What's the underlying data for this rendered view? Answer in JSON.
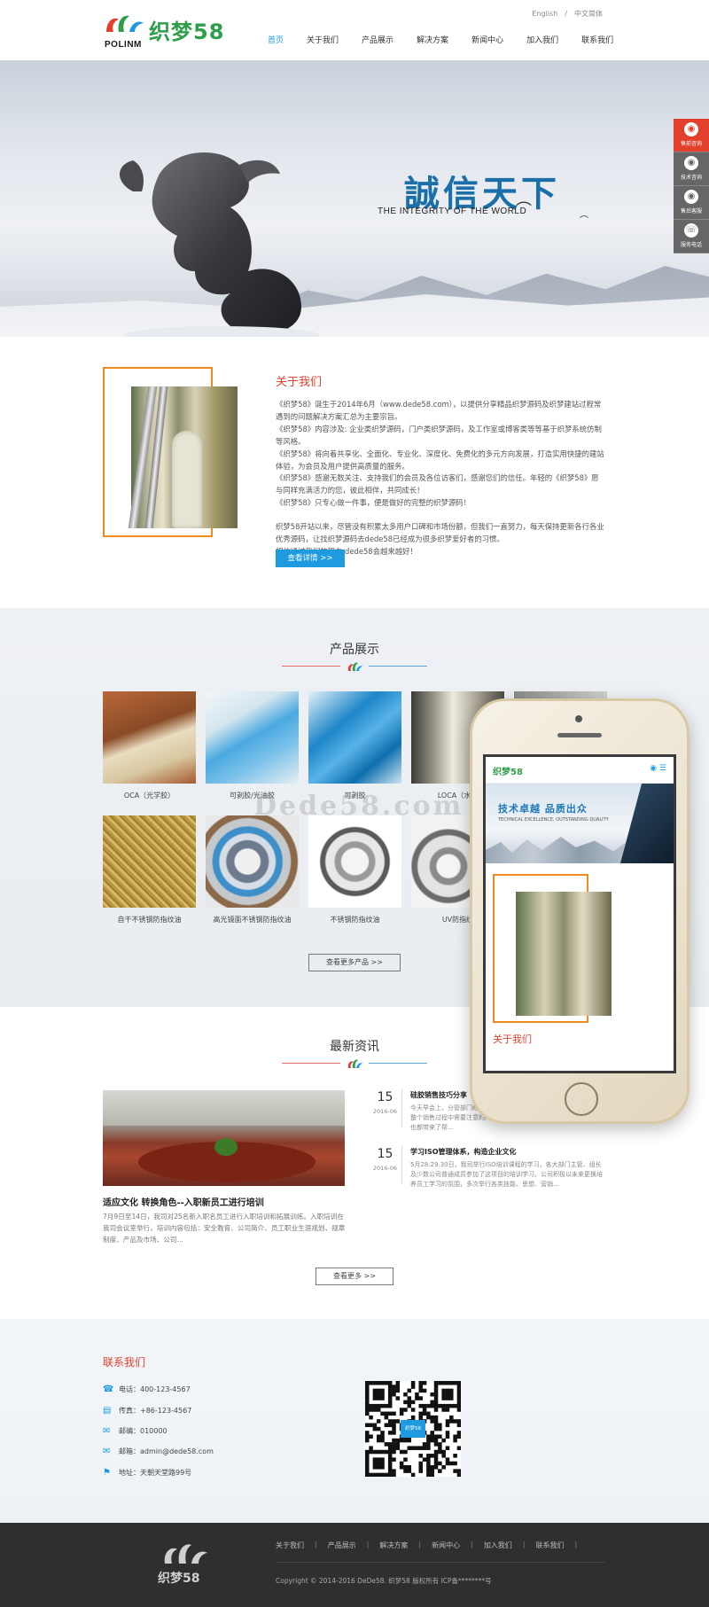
{
  "header": {
    "logo_en": "POLINM",
    "logo_cn": "织梦58",
    "lang": [
      "English",
      "/",
      "中文简体"
    ],
    "nav": [
      "首页",
      "关于我们",
      "产品展示",
      "解决方案",
      "新闻中心",
      "加入我们",
      "联系我们"
    ]
  },
  "banner": {
    "slogan_cn": "誠信天下",
    "slogan_en": "THE INTEGRITY OF THE WORLD",
    "dot_colors": [
      "#29a3e6",
      "#e2402d"
    ]
  },
  "side": [
    "售前咨询",
    "技术咨询",
    "售后客服",
    "服务电话"
  ],
  "about": {
    "title": "关于我们",
    "paragraphs": [
      "《织梦58》诞生于2014年6月（www.dede58.com），以提供分享精品织梦源码及织梦建站过程常遇到的问题解决方案汇总为主要宗旨。",
      "《织梦58》内容涉及: 企业类织梦源码，门户类织梦源码，及工作室或博客类等等基于织梦系统仿制等风格。",
      "《织梦58》将向着共享化、全面化、专业化、深度化、免费化的多元方向发展，打造实用快捷的建站体验，为会员及用户提供高质量的服务。",
      "《织梦58》感谢无数关注、支持我们的会员及各位访客们，感谢您们的信任。年轻的《织梦58》愿与同样充满活力的您，彼此相伴，共同成长！",
      "《织梦58》只专心做一件事，便是做好的完整的织梦源码！"
    ],
    "paragraphs2": [
      "织梦58开站以来，尽管没有积累太多用户口碑和市场份额，但我们一直努力，每天保持更新各行各业优秀源码，让找织梦源码去dede58已经成为很多织梦爱好者的习惯。",
      "相信通过我们的努力,dede58会越来越好！"
    ],
    "button": "查看详情 >>"
  },
  "products": {
    "title": "产品展示",
    "items": [
      {
        "caption": "OCA（光学胶）"
      },
      {
        "caption": "可剥胶/光油胶"
      },
      {
        "caption": "可剥胶"
      },
      {
        "caption": "LOCA（水胶"
      },
      {
        "caption": ""
      },
      {
        "caption": "自干不锈钢防指纹油"
      },
      {
        "caption": "高光镜面不锈钢防指纹油"
      },
      {
        "caption": "不锈钢防指纹油"
      },
      {
        "caption": "UV防指纹"
      }
    ],
    "more": "查看更多产品 >>",
    "watermark": "Dede58.com"
  },
  "phone": {
    "logo": "织梦58",
    "slogan": "技术卓越  品质出众",
    "sub": "TECHNICAL EXCELLENCE, OUTSTANDING QUALITY",
    "title": "关于我们"
  },
  "news": {
    "title": "最新资讯",
    "featured_title": "适应文化 转换角色--入职新员工进行培训",
    "featured_desc": "7月9日至14日，我司对25名新入职名员工进行入职培训和拓展训练。入职培训在我司会议室举行，培训内容包括：安全教育、公司简介、员工职业生涯规划、规章制度、产品及市场、公司...",
    "items": [
      {
        "day": "15",
        "ym": "2016-06",
        "title": "硅胶销售技巧分享",
        "summary": "今天早会上，分管部门经理与大家分享了关于销售的技巧，大部分的是整个销售过程中需要注意的问题，总结了很多个案例供整个公司的员工也都带来了帮..."
      },
      {
        "day": "15",
        "ym": "2016-06",
        "title": "学习ISO管理体系，构造企业文化",
        "summary": "5月28.29.30日，我司举行ISO培训课程的学习，各大部门主管、组长及少数公司普通成员参加了这项目的培训学习。公司积极以未来更换培养员工学习的氛围，多次举行各类技能、思想、营销..."
      }
    ],
    "more": "查看更多 >>"
  },
  "contact": {
    "title": "联系我们",
    "items": [
      {
        "icon": "phone-icon",
        "text": "电话：400-123-4567"
      },
      {
        "icon": "fax-icon",
        "text": "传真：+86-123-4567"
      },
      {
        "icon": "mail-icon",
        "text": "邮编：010000"
      },
      {
        "icon": "email-icon",
        "text": "邮箱：admin@dede58.com"
      },
      {
        "icon": "location-icon",
        "text": "地址：天朝天堂路99号"
      }
    ],
    "qr_label": "织梦58"
  },
  "footer": {
    "logo": "织梦58",
    "links": [
      "关于我们",
      "产品展示",
      "解决方案",
      "新闻中心",
      "加入我们",
      "联系我们"
    ],
    "copyright": "Copyright © 2014-2016 DeDe58. 织梦58 版权所有    ICP备********号"
  }
}
